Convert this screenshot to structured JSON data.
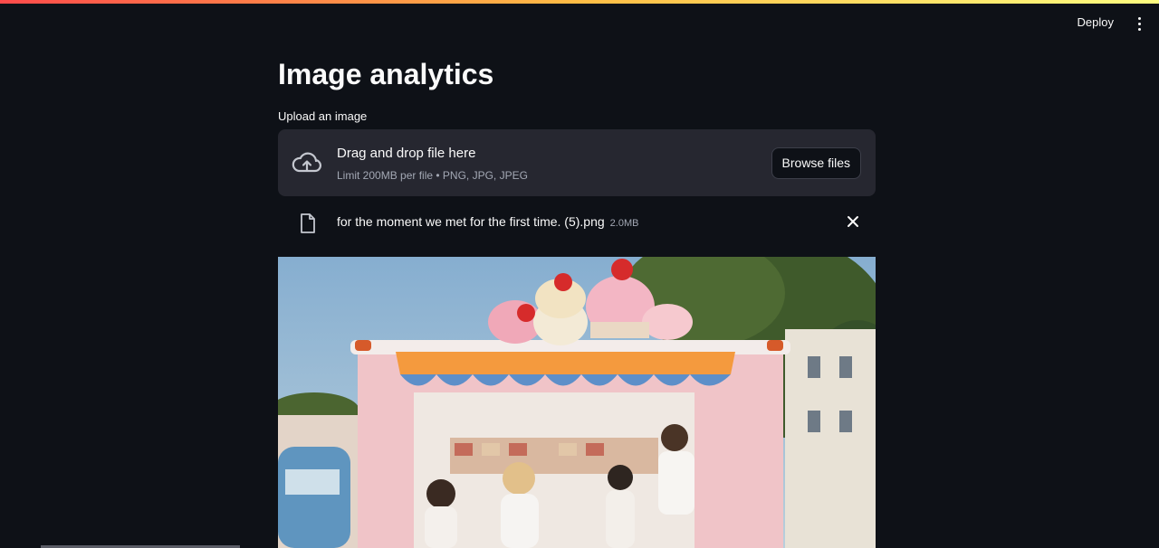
{
  "header": {
    "deploy_label": "Deploy",
    "menu_icon": "kebab-menu-icon"
  },
  "main": {
    "title": "Image analytics",
    "upload_label": "Upload an image",
    "dropzone": {
      "title": "Drag and drop file here",
      "subtitle": "Limit 200MB per file • PNG, JPG, JPEG",
      "browse_label": "Browse files",
      "icon": "cloud-upload-icon"
    },
    "file": {
      "name": "for the moment we met for the first time. (5).png",
      "size": "2.0MB",
      "icon": "file-icon",
      "remove_icon": "close-icon"
    },
    "image": {
      "description_icon": "uploaded-image"
    }
  },
  "colors": {
    "background": "#0e1117",
    "dropzone": "#262730",
    "text": "#fafafa",
    "muted": "#a3a8b4"
  }
}
